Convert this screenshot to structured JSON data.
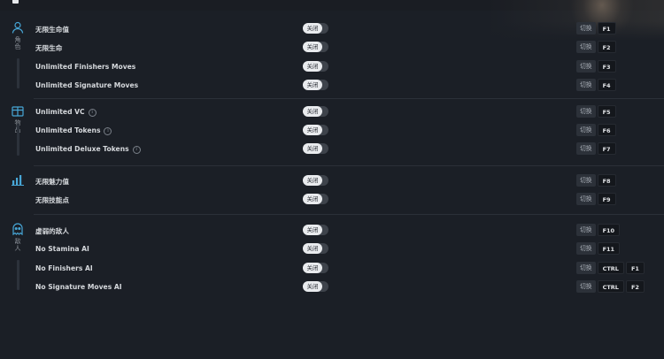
{
  "toggle_off_label": "关闭",
  "action_label": "切换",
  "colors": {
    "accent": "#47a6d6",
    "background": "#1b1f26",
    "toggle_pill": "#e9ebee"
  },
  "sections": [
    {
      "icon": "user-icon",
      "label": "角色",
      "rows": [
        {
          "label": "无限生命值",
          "info": false,
          "keys": [
            "F1"
          ]
        },
        {
          "label": "无限生命",
          "info": false,
          "keys": [
            "F2"
          ]
        },
        {
          "label": "Unlimited Finishers Moves",
          "info": false,
          "keys": [
            "F3"
          ]
        },
        {
          "label": "Unlimited Signature Moves",
          "info": false,
          "keys": [
            "F4"
          ]
        }
      ]
    },
    {
      "icon": "gift-box-icon",
      "label": "物品",
      "rows": [
        {
          "label": "Unlimited VC",
          "info": true,
          "keys": [
            "F5"
          ]
        },
        {
          "label": "Unlimited Tokens",
          "info": true,
          "keys": [
            "F6"
          ]
        },
        {
          "label": "Unlimited Deluxe Tokens",
          "info": true,
          "keys": [
            "F7"
          ]
        }
      ]
    },
    {
      "icon": "bar-chart-icon",
      "label": "",
      "rows": [
        {
          "label": "无限魅力值",
          "info": false,
          "keys": [
            "F8"
          ]
        },
        {
          "label": "无限技能点",
          "info": false,
          "keys": [
            "F9"
          ]
        }
      ]
    },
    {
      "icon": "ghost-icon",
      "label": "敌人",
      "rows": [
        {
          "label": "虚弱的敌人",
          "info": false,
          "keys": [
            "F10"
          ]
        },
        {
          "label": "No Stamina AI",
          "info": false,
          "keys": [
            "F11"
          ]
        },
        {
          "label": "No Finishers AI",
          "info": false,
          "keys": [
            "CTRL",
            "F1"
          ]
        },
        {
          "label": "No Signature Moves AI",
          "info": false,
          "keys": [
            "CTRL",
            "F2"
          ]
        }
      ]
    }
  ]
}
